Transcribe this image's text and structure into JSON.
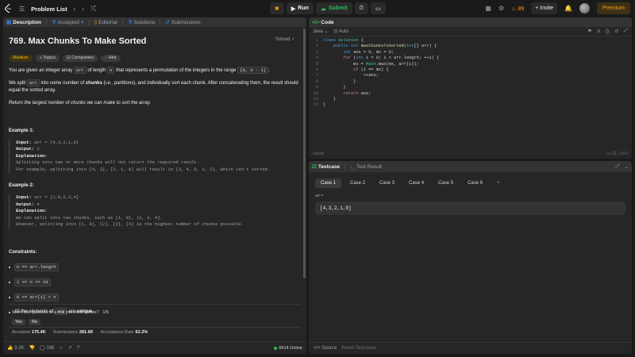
{
  "topbar": {
    "title": "Problem List",
    "run_label": "Run",
    "submit_label": "Submit",
    "streak": "89",
    "invite_label": "Invite",
    "premium_label": "Premium"
  },
  "left_tabs": {
    "description": "Description",
    "accepted": "Accepted",
    "editorial": "Editorial",
    "solutions": "Solutions",
    "submissions": "Submissions"
  },
  "problem": {
    "title": "769. Max Chunks To Make Sorted",
    "solved_label": "Solved",
    "difficulty": "Medium",
    "topics": "Topics",
    "companies": "Companies",
    "hint": "Hint",
    "p1_a": "You are given an integer array ",
    "p1_code1": "arr",
    "p1_b": " of length ",
    "p1_code2": "n",
    "p1_c": " that represents a permutation of the integers in the range ",
    "p1_code3": "[0, n - 1]",
    "p1_d": ".",
    "p2_a": "We split ",
    "p2_code": "arr",
    "p2_b": " into some number of ",
    "p2_bold": "chunks",
    "p2_c": " (i.e., partitions), and individually sort each chunk. After concatenating them, the result should equal the sorted array.",
    "p3": "Return the largest number of chunks we can make to sort the array.",
    "ex1_title": "Example 1:",
    "ex1_input_label": "Input:",
    "ex1_input": "arr = [4,3,2,1,0]",
    "ex1_output_label": "Output:",
    "ex1_output": "1",
    "ex1_expl_label": "Explanation:",
    "ex1_expl1": "Splitting into two or more chunks will not return the required result.",
    "ex1_expl2": "For example, splitting into [4, 3], [2, 1, 0] will result in [3, 4, 0, 1, 2], which isn't sorted.",
    "ex2_title": "Example 2:",
    "ex2_input_label": "Input:",
    "ex2_input": "arr = [1,0,2,3,4]",
    "ex2_output_label": "Output:",
    "ex2_output": "4",
    "ex2_expl_label": "Explanation:",
    "ex2_expl1": "We can split into two chunks, such as [1, 0], [2, 3, 4].",
    "ex2_expl2": "However, splitting into [1, 0], [2], [3], [4] is the highest number of chunks possible.",
    "constraints_title": "Constraints:",
    "c1": "n == arr.length",
    "c2": "1 <= n <= 10",
    "c3": "0 <= arr[i] < n",
    "c4_a": "All the elements of ",
    "c4_code": "arr",
    "c4_b": " are ",
    "c4_bold": "unique",
    "c4_c": "."
  },
  "interview": {
    "question": "Seen this question in a real interview before?",
    "count": "1/5",
    "yes": "Yes",
    "no": "No"
  },
  "stats": {
    "accepted_label": "Accepted",
    "accepted_value": "175.4K",
    "submissions_label": "Submissions",
    "submissions_value": "281.6K",
    "rate_label": "Acceptance Rate",
    "rate_value": "62.3%"
  },
  "bottom": {
    "likes": "3.3K",
    "comments": "166",
    "online": "6614 Online"
  },
  "code": {
    "tab_label": "Code",
    "language": "Java",
    "auto": "Auto",
    "saved": "Saved",
    "cursor": "Ln 12, Col 2"
  },
  "testcase": {
    "tab_label": "Testcase",
    "result_label": "Test Result",
    "cases": [
      "Case 1",
      "Case 2",
      "Case 3",
      "Case 4",
      "Case 5",
      "Case 6"
    ],
    "var_name": "arr =",
    "value": "[4,3,2,1,0]",
    "source_label": "Source",
    "reset_label": "Reset Testcases"
  },
  "colors": {
    "background": "#1a1a1a",
    "panel": "#262626",
    "accent_green": "#2cbb5d",
    "accent_orange": "#ffa116",
    "medium": "#ffb800"
  }
}
